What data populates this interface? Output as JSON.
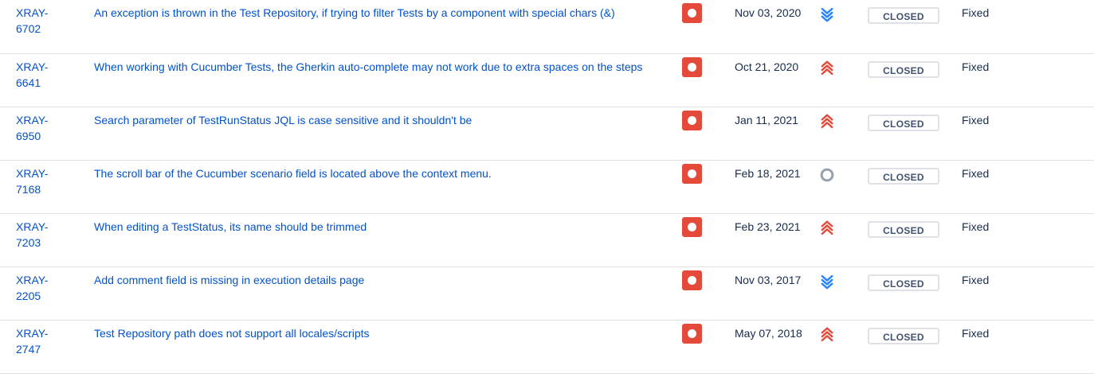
{
  "colors": {
    "link": "#0052cc",
    "bug": "#e5493a",
    "highest": "#e5493a",
    "lowest": "#2684ff",
    "medium": "#97a0af"
  },
  "rows": [
    {
      "key": "XRAY-6702",
      "summary": "An exception is thrown in the Test Repository, if trying to filter Tests by a component with special chars (&)",
      "type_icon": "bug-icon",
      "date": "Nov 03, 2020",
      "priority": "lowest",
      "status": "CLOSED",
      "resolution": "Fixed"
    },
    {
      "key": "XRAY-6641",
      "summary": "When working with Cucumber Tests, the Gherkin auto-complete may not work due to extra spaces on the steps",
      "type_icon": "bug-icon",
      "date": "Oct 21, 2020",
      "priority": "highest",
      "status": "CLOSED",
      "resolution": "Fixed"
    },
    {
      "key": "XRAY-6950",
      "summary": "Search parameter of TestRunStatus JQL is case sensitive and it shouldn't be",
      "type_icon": "bug-icon",
      "date": "Jan 11, 2021",
      "priority": "highest",
      "status": "CLOSED",
      "resolution": "Fixed"
    },
    {
      "key": "XRAY-7168",
      "summary": "The scroll bar of the Cucumber scenario field is located above the context menu.",
      "type_icon": "bug-icon",
      "date": "Feb 18, 2021",
      "priority": "medium",
      "status": "CLOSED",
      "resolution": "Fixed"
    },
    {
      "key": "XRAY-7203",
      "summary": "When editing a TestStatus, its name should be trimmed",
      "type_icon": "bug-icon",
      "date": "Feb 23, 2021",
      "priority": "highest",
      "status": "CLOSED",
      "resolution": "Fixed"
    },
    {
      "key": "XRAY-2205",
      "summary": "Add comment field is missing in execution details page",
      "type_icon": "bug-icon",
      "date": "Nov 03, 2017",
      "priority": "lowest",
      "status": "CLOSED",
      "resolution": "Fixed"
    },
    {
      "key": "XRAY-2747",
      "summary": "Test Repository path does not support all locales/scripts",
      "type_icon": "bug-icon",
      "date": "May 07, 2018",
      "priority": "highest",
      "status": "CLOSED",
      "resolution": "Fixed"
    }
  ]
}
